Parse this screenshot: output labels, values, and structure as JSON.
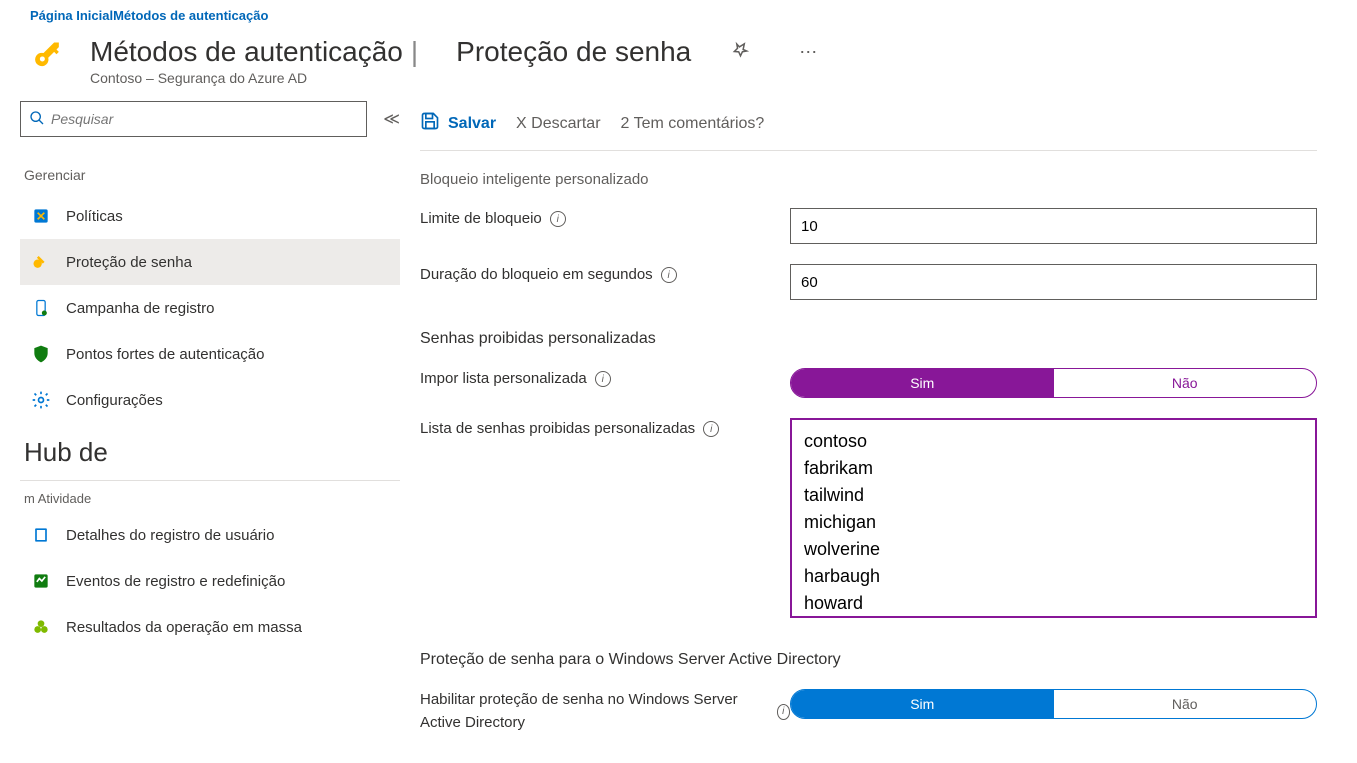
{
  "breadcrumb": {
    "home": "Página Inicial",
    "current": "Métodos de autenticação"
  },
  "header": {
    "title_left": "Métodos de autenticação",
    "title_right": "Proteção de senha",
    "subtitle": "Contoso –  Segurança do Azure AD"
  },
  "sidebar": {
    "search_placeholder": "Pesquisar",
    "group_manage": "Gerenciar",
    "items": [
      {
        "label": "Políticas"
      },
      {
        "label": "Proteção de senha"
      },
      {
        "label": "Campanha de registro"
      },
      {
        "label": "Pontos fortes de autenticação"
      },
      {
        "label": "Configurações"
      }
    ],
    "hub_title": "Hub de",
    "hub_sub": "m Atividade",
    "hub_items": [
      {
        "label": "Detalhes do registro de usuário"
      },
      {
        "label": "Eventos de registro e redefinição"
      },
      {
        "label": "Resultados da operação em massa"
      }
    ]
  },
  "toolbar": {
    "save": "Salvar",
    "discard": "X   Descartar",
    "feedback": "2 Tem comentários?"
  },
  "form": {
    "section_lockout": "Bloqueio inteligente personalizado",
    "lockout_threshold_label": "Limite de bloqueio",
    "lockout_threshold_value": "10",
    "lockout_duration_label": "Duração do bloqueio em segundos",
    "lockout_duration_value": "60",
    "section_banned": "Senhas proibidas personalizadas",
    "enforce_list_label": "Impor lista personalizada",
    "toggle_yes": "Sim",
    "toggle_no": "Não",
    "banned_list_label": "Lista de senhas proibidas personalizadas",
    "banned_list_value": "contoso\nfabrikam\ntailwind\nmichigan\nwolverine\nharbaugh\nhoward",
    "section_winserver": "Proteção de senha para o Windows Server Active Directory",
    "enable_winserver_label": "Habilitar proteção de senha no Windows Server Active Directory"
  }
}
